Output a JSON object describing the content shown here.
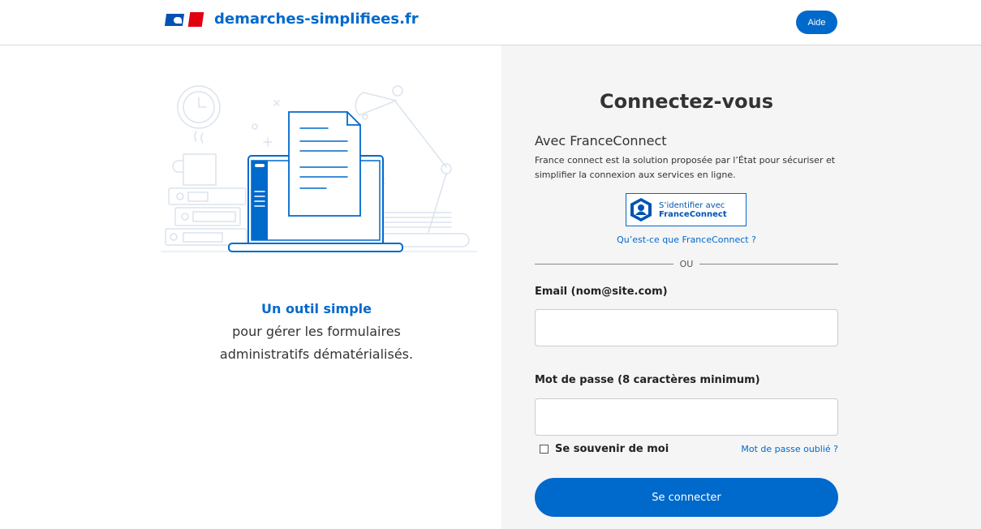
{
  "header": {
    "site_name": "demarches-simplifiees.fr",
    "help_label": "Aide"
  },
  "left": {
    "tagline_title": "Un outil simple",
    "tagline_line1": "pour gérer les formulaires",
    "tagline_line2": "administratifs dématérialisés."
  },
  "login": {
    "title": "Connectez-vous",
    "franceconnect": {
      "heading": "Avec FranceConnect",
      "description": "France connect est la solution proposée par l’État pour sécuriser et simplifier la connexion aux services en ligne.",
      "button_line1": "S’identifier avec",
      "button_line2": "FranceConnect",
      "what_is_link": "Qu’est-ce que FranceConnect ?"
    },
    "or_separator": "OU",
    "email_label": "Email (nom@site.com)",
    "email_value": "",
    "password_label": "Mot de passe (8 caractères minimum)",
    "password_value": "",
    "remember_label": "Se souvenir de moi",
    "remember_checked": false,
    "forgot_link": "Mot de passe oublié ?",
    "submit_label": "Se connecter"
  },
  "colors": {
    "accent": "#0069cc",
    "right_panel_bg": "#f5f5f5",
    "flag_blue": "#0053b3",
    "flag_red": "#e1000f"
  },
  "icons": {
    "logo": "marianne-flag-logo",
    "franceconnect": "franceconnect-logo",
    "illustration": "laptop-document-desk-illustration"
  }
}
